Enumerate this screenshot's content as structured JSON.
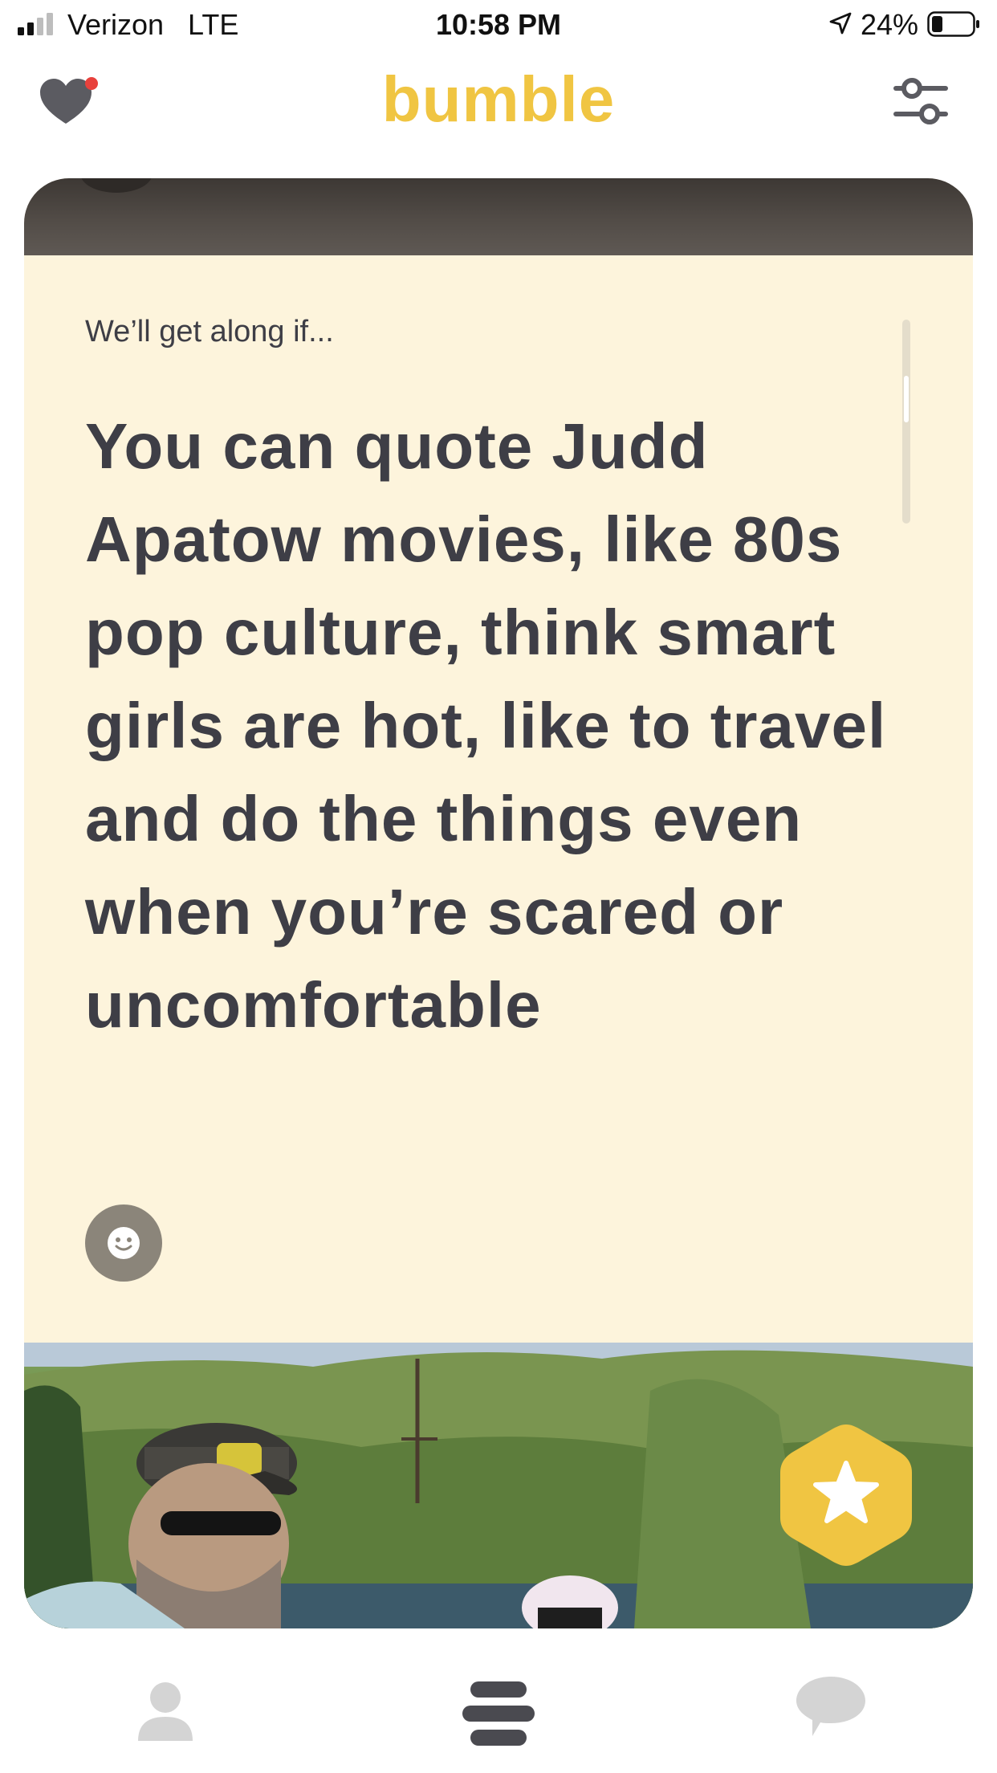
{
  "status_bar": {
    "carrier": "Verizon",
    "network": "LTE",
    "time": "10:58 PM",
    "battery_percent": "24%"
  },
  "header": {
    "logo": "bumble",
    "left_icon": "heart-icon",
    "right_icon": "filter-sliders-icon"
  },
  "profile_card": {
    "prompt_label": "We’ll get along if...",
    "prompt_answer": "You can quote Judd Apatow movies, like 80s pop culture, think smart girls are hot, like to travel and do the things even when you’re scared or uncomfortable",
    "reaction_icon": "smile-icon",
    "superswipe_icon": "star-icon"
  },
  "tab_bar": {
    "items": [
      {
        "icon": "profile-icon",
        "active": false
      },
      {
        "icon": "people-stack-icon",
        "active": true
      },
      {
        "icon": "chat-bubble-icon",
        "active": false
      }
    ]
  },
  "colors": {
    "brand_yellow": "#f0c542",
    "card_background": "#fdf4dc",
    "text_dark": "#3e3e46",
    "notification_red": "#e8413c",
    "inactive_tab": "#d4d4d4"
  }
}
